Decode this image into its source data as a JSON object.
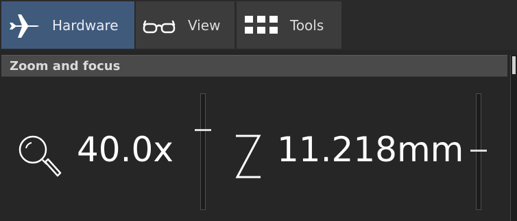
{
  "tabs": [
    {
      "label": "Hardware",
      "icon": "airplane-icon",
      "active": true
    },
    {
      "label": "View",
      "icon": "glasses-icon",
      "active": false
    },
    {
      "label": "Tools",
      "icon": "grid-icon",
      "active": false
    }
  ],
  "section": {
    "title": "Zoom and focus"
  },
  "zoom": {
    "icon": "magnifier-icon",
    "value": "40.0x",
    "slider_level": 0.31
  },
  "focus": {
    "icon": "z-axis-icon",
    "value": "11.218mm",
    "slider_level": 0.49
  },
  "colors": {
    "active_tab": "#405a7c",
    "inactive_tab": "#3c3c3c",
    "background": "#262626",
    "header": "#4a4a4a",
    "text": "#ffffff"
  }
}
